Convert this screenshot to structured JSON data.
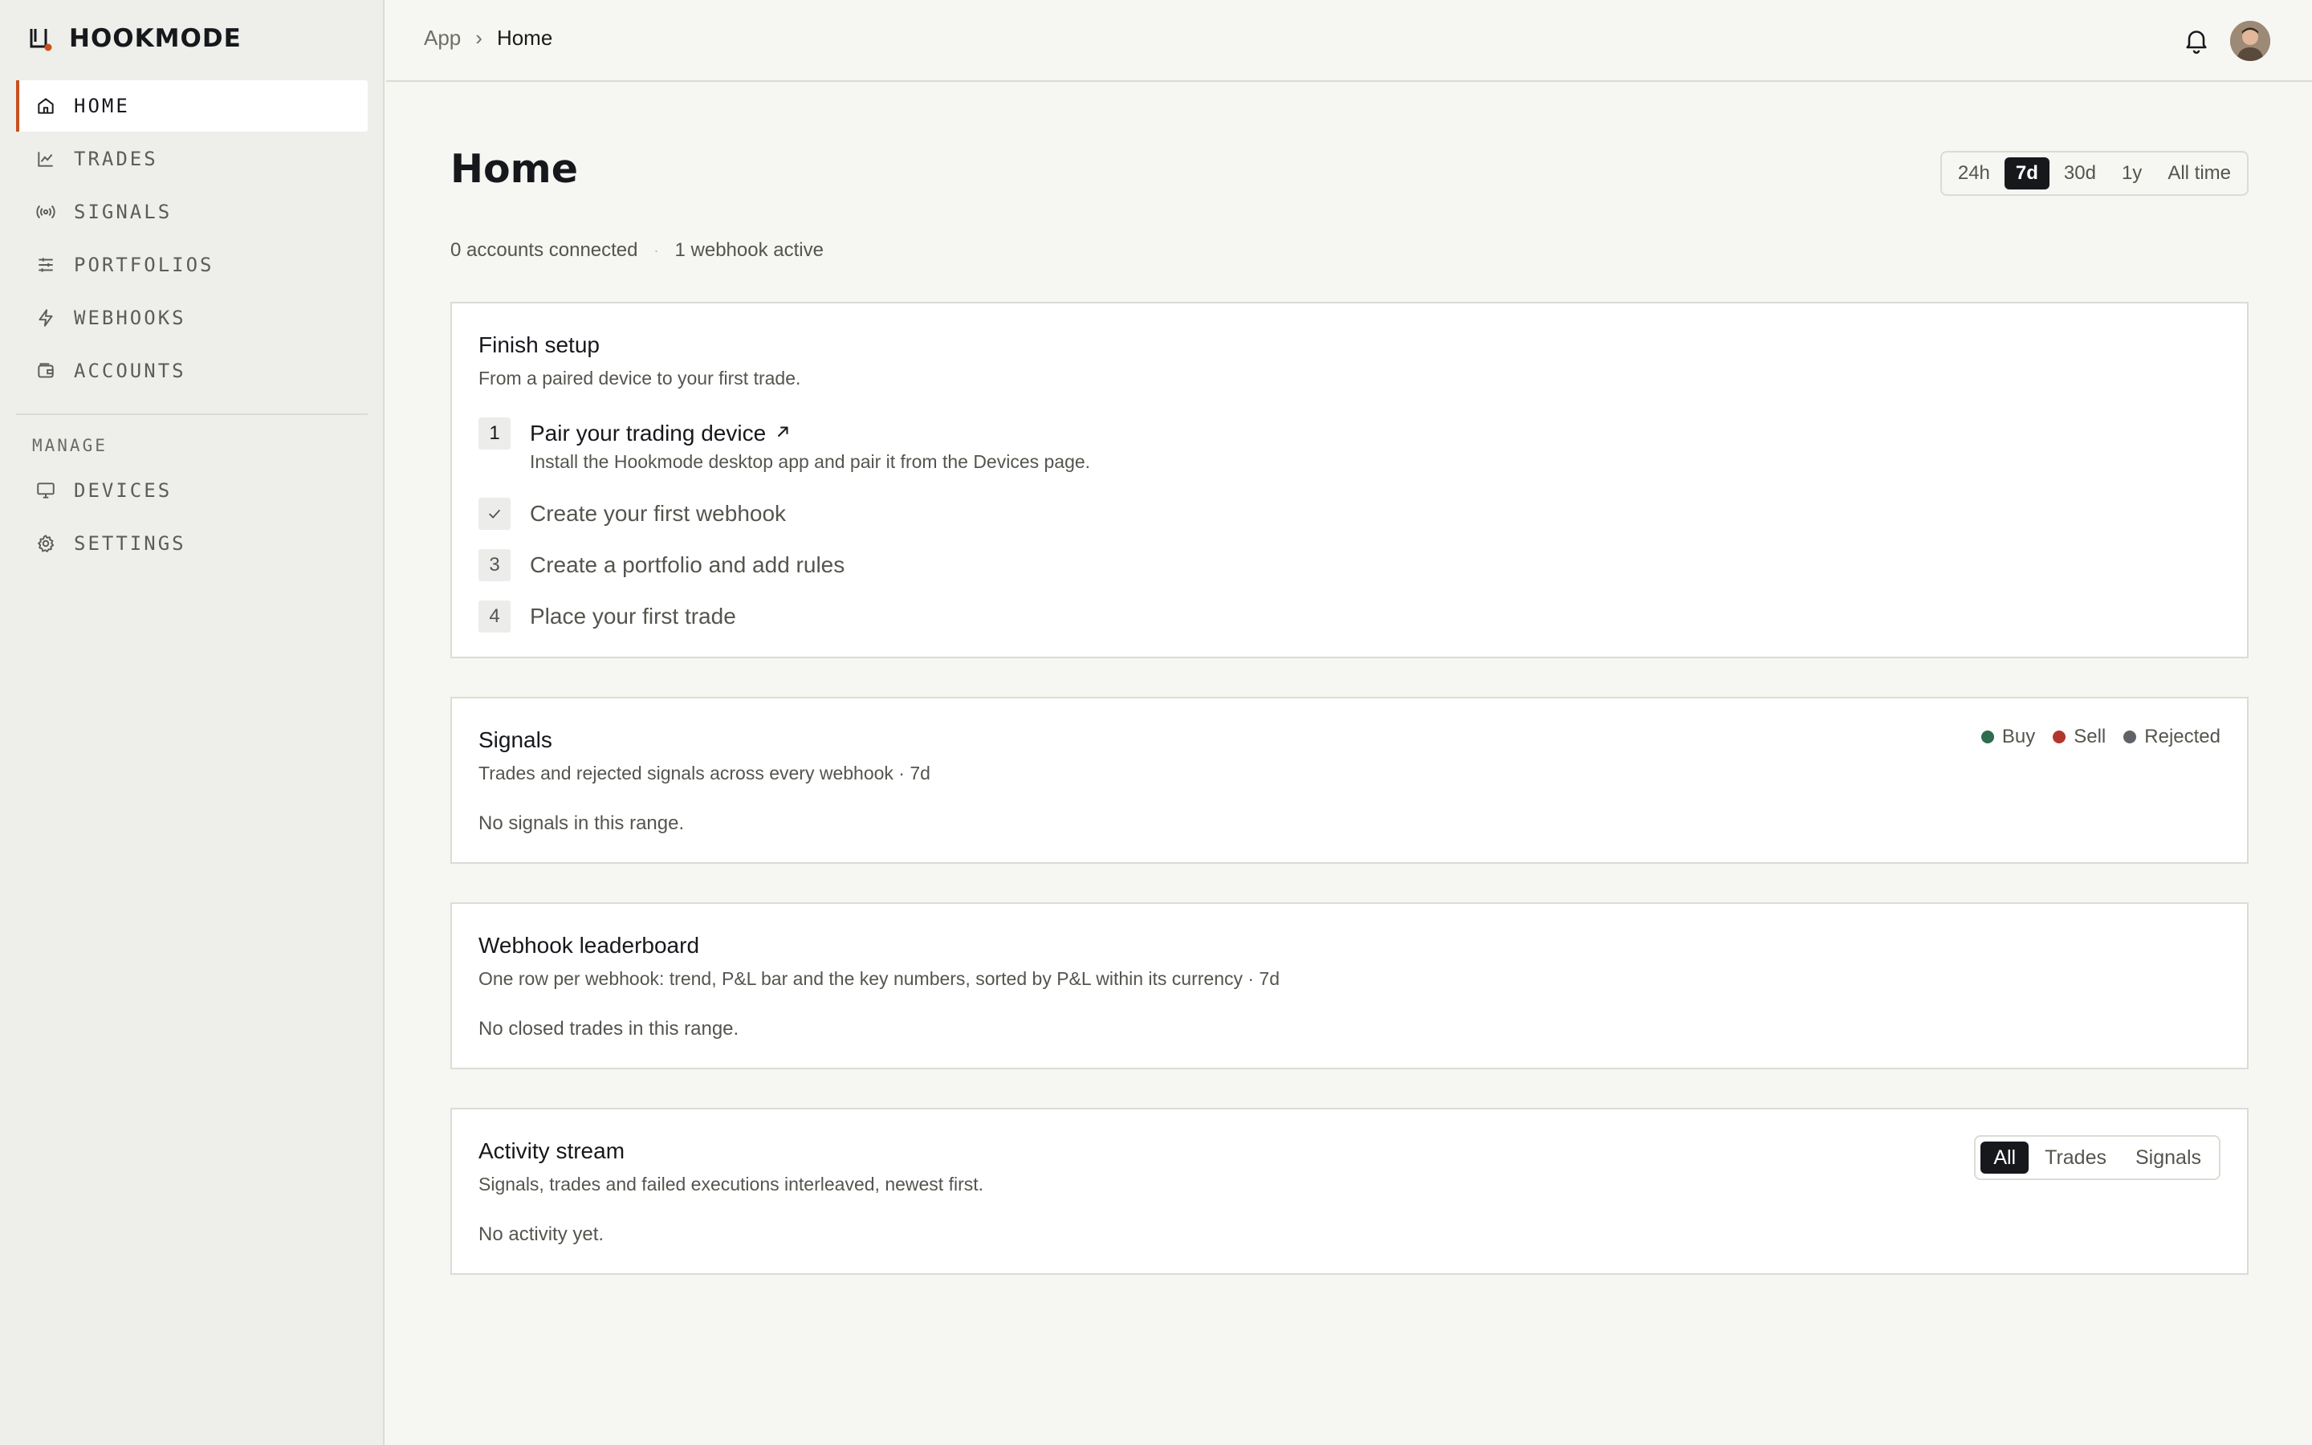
{
  "brand": {
    "name": "HOOKMODE",
    "logo_icon": "hook-logo-icon"
  },
  "sidebar": {
    "items": [
      {
        "label": "HOME",
        "icon": "home-icon",
        "active": true
      },
      {
        "label": "TRADES",
        "icon": "line-chart-icon"
      },
      {
        "label": "SIGNALS",
        "icon": "broadcast-icon"
      },
      {
        "label": "PORTFOLIOS",
        "icon": "sliders-icon"
      },
      {
        "label": "WEBHOOKS",
        "icon": "bolt-icon"
      },
      {
        "label": "ACCOUNTS",
        "icon": "wallet-icon"
      }
    ],
    "section_label": "MANAGE",
    "manage_items": [
      {
        "label": "DEVICES",
        "icon": "monitor-icon"
      },
      {
        "label": "SETTINGS",
        "icon": "gear-icon"
      }
    ]
  },
  "topbar": {
    "breadcrumb": {
      "root": "App",
      "separator": "›",
      "current": "Home"
    }
  },
  "page": {
    "title": "Home",
    "range_tabs": [
      "24h",
      "7d",
      "30d",
      "1y",
      "All time"
    ],
    "range_selected": "7d",
    "meta": {
      "accounts": "0 accounts connected",
      "dot": "·",
      "webhooks": "1 webhook active"
    }
  },
  "setup": {
    "title": "Finish setup",
    "subtitle": "From a paired device to your first trade.",
    "steps": [
      {
        "badge": "1",
        "label": "Pair your trading device",
        "desc": "Install the Hookmode desktop app and pair it from the Devices page."
      },
      {
        "badge": "✓",
        "label": "Create your first webhook"
      },
      {
        "badge": "3",
        "label": "Create a portfolio and add rules"
      },
      {
        "badge": "4",
        "label": "Place your first trade"
      }
    ]
  },
  "signals": {
    "title": "Signals",
    "subtitle": "Trades and rejected signals across every webhook · 7d",
    "empty": "No signals in this range.",
    "legend": [
      {
        "label": "Buy",
        "color": "#2e6b4f"
      },
      {
        "label": "Sell",
        "color": "#b3362d"
      },
      {
        "label": "Rejected",
        "color": "#5f6368"
      }
    ]
  },
  "leaderboard": {
    "title": "Webhook leaderboard",
    "subtitle": "One row per webhook: trend, P&L bar and the key numbers, sorted by P&L within its currency · 7d",
    "empty": "No closed trades in this range."
  },
  "activity": {
    "title": "Activity stream",
    "subtitle": "Signals, trades and failed executions interleaved, newest first.",
    "empty": "No activity yet.",
    "tabs": [
      "All",
      "Trades",
      "Signals"
    ],
    "selected": "All"
  },
  "colors": {
    "accent": "#c8501f",
    "ink": "#16181c",
    "background": "#f6f6f2"
  }
}
